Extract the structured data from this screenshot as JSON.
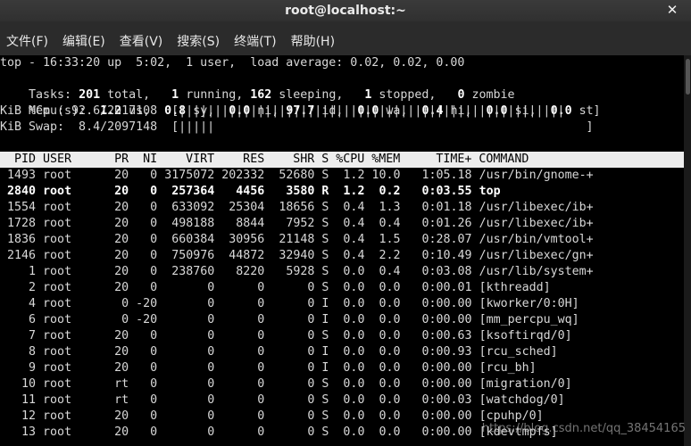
{
  "window": {
    "title": "root@localhost:~",
    "close_glyph": "✕"
  },
  "menu": [
    "文件(F)",
    "编辑(E)",
    "查看(V)",
    "搜索(S)",
    "终端(T)",
    "帮助(H)"
  ],
  "summary": {
    "line1": "top - 16:33:20 up  5:02,  1 user,  load average: 0.02, 0.02, 0.00",
    "tasks": [
      "Tasks: ",
      "201",
      " total,   ",
      "1",
      " running, ",
      "162",
      " sleeping,   ",
      "1",
      " stopped,   ",
      "0",
      " zombie"
    ],
    "cpu": [
      "%Cpu(s):  ",
      "1.2",
      " us,  ",
      "0.8",
      " sy,  ",
      "0.0",
      " ni, ",
      "97.7",
      " id,  ",
      "0.0",
      " wa,  ",
      "0.4",
      " hi,  ",
      "0.0",
      " si,  ",
      "0.0",
      " st"
    ],
    "mem": "KiB Mem : 92.6/2017108  [||||||||||||||||||||||||||||||||||||||||||||||||||||||    ]",
    "swap": "KiB Swap:  8.4/2097148  [|||||                                                    ]"
  },
  "table_header": "  PID USER      PR  NI    VIRT    RES    SHR S %CPU %MEM     TIME+ COMMAND           ",
  "processes": [
    {
      "pid": "1493",
      "user": "root",
      "pr": "20",
      "ni": "0",
      "virt": "3175072",
      "res": "202332",
      "shr": "52680",
      "s": "S",
      "cpu": "1.2",
      "mem": "10.0",
      "time": "1:05.18",
      "cmd": "/usr/bin/gnome-+",
      "bold": false
    },
    {
      "pid": "2840",
      "user": "root",
      "pr": "20",
      "ni": "0",
      "virt": "257364",
      "res": "4456",
      "shr": "3580",
      "s": "R",
      "cpu": "1.2",
      "mem": "0.2",
      "time": "0:03.55",
      "cmd": "top",
      "bold": true
    },
    {
      "pid": "1554",
      "user": "root",
      "pr": "20",
      "ni": "0",
      "virt": "633092",
      "res": "25304",
      "shr": "18656",
      "s": "S",
      "cpu": "0.4",
      "mem": "1.3",
      "time": "0:01.18",
      "cmd": "/usr/libexec/ib+",
      "bold": false
    },
    {
      "pid": "1728",
      "user": "root",
      "pr": "20",
      "ni": "0",
      "virt": "498188",
      "res": "8844",
      "shr": "7952",
      "s": "S",
      "cpu": "0.4",
      "mem": "0.4",
      "time": "0:01.26",
      "cmd": "/usr/libexec/ib+",
      "bold": false
    },
    {
      "pid": "1836",
      "user": "root",
      "pr": "20",
      "ni": "0",
      "virt": "660384",
      "res": "30956",
      "shr": "21148",
      "s": "S",
      "cpu": "0.4",
      "mem": "1.5",
      "time": "0:28.07",
      "cmd": "/usr/bin/vmtool+",
      "bold": false
    },
    {
      "pid": "2146",
      "user": "root",
      "pr": "20",
      "ni": "0",
      "virt": "750976",
      "res": "44872",
      "shr": "32940",
      "s": "S",
      "cpu": "0.4",
      "mem": "2.2",
      "time": "0:10.49",
      "cmd": "/usr/libexec/gn+",
      "bold": false
    },
    {
      "pid": "1",
      "user": "root",
      "pr": "20",
      "ni": "0",
      "virt": "238760",
      "res": "8220",
      "shr": "5928",
      "s": "S",
      "cpu": "0.0",
      "mem": "0.4",
      "time": "0:03.08",
      "cmd": "/usr/lib/system+",
      "bold": false
    },
    {
      "pid": "2",
      "user": "root",
      "pr": "20",
      "ni": "0",
      "virt": "0",
      "res": "0",
      "shr": "0",
      "s": "S",
      "cpu": "0.0",
      "mem": "0.0",
      "time": "0:00.01",
      "cmd": "[kthreadd]",
      "bold": false
    },
    {
      "pid": "4",
      "user": "root",
      "pr": "0",
      "ni": "-20",
      "virt": "0",
      "res": "0",
      "shr": "0",
      "s": "I",
      "cpu": "0.0",
      "mem": "0.0",
      "time": "0:00.00",
      "cmd": "[kworker/0:0H]",
      "bold": false
    },
    {
      "pid": "6",
      "user": "root",
      "pr": "0",
      "ni": "-20",
      "virt": "0",
      "res": "0",
      "shr": "0",
      "s": "I",
      "cpu": "0.0",
      "mem": "0.0",
      "time": "0:00.00",
      "cmd": "[mm_percpu_wq]",
      "bold": false
    },
    {
      "pid": "7",
      "user": "root",
      "pr": "20",
      "ni": "0",
      "virt": "0",
      "res": "0",
      "shr": "0",
      "s": "S",
      "cpu": "0.0",
      "mem": "0.0",
      "time": "0:00.63",
      "cmd": "[ksoftirqd/0]",
      "bold": false
    },
    {
      "pid": "8",
      "user": "root",
      "pr": "20",
      "ni": "0",
      "virt": "0",
      "res": "0",
      "shr": "0",
      "s": "I",
      "cpu": "0.0",
      "mem": "0.0",
      "time": "0:00.93",
      "cmd": "[rcu_sched]",
      "bold": false
    },
    {
      "pid": "9",
      "user": "root",
      "pr": "20",
      "ni": "0",
      "virt": "0",
      "res": "0",
      "shr": "0",
      "s": "I",
      "cpu": "0.0",
      "mem": "0.0",
      "time": "0:00.00",
      "cmd": "[rcu_bh]",
      "bold": false
    },
    {
      "pid": "10",
      "user": "root",
      "pr": "rt",
      "ni": "0",
      "virt": "0",
      "res": "0",
      "shr": "0",
      "s": "S",
      "cpu": "0.0",
      "mem": "0.0",
      "time": "0:00.00",
      "cmd": "[migration/0]",
      "bold": false
    },
    {
      "pid": "11",
      "user": "root",
      "pr": "rt",
      "ni": "0",
      "virt": "0",
      "res": "0",
      "shr": "0",
      "s": "S",
      "cpu": "0.0",
      "mem": "0.0",
      "time": "0:00.03",
      "cmd": "[watchdog/0]",
      "bold": false
    },
    {
      "pid": "12",
      "user": "root",
      "pr": "20",
      "ni": "0",
      "virt": "0",
      "res": "0",
      "shr": "0",
      "s": "S",
      "cpu": "0.0",
      "mem": "0.0",
      "time": "0:00.00",
      "cmd": "[cpuhp/0]",
      "bold": false
    },
    {
      "pid": "13",
      "user": "root",
      "pr": "20",
      "ni": "0",
      "virt": "0",
      "res": "0",
      "shr": "0",
      "s": "S",
      "cpu": "0.0",
      "mem": "0.0",
      "time": "0:00.00",
      "cmd": "[kdevtmpfs]",
      "bold": false
    }
  ],
  "watermark": "https://blog.csdn.net/qq_38454165"
}
